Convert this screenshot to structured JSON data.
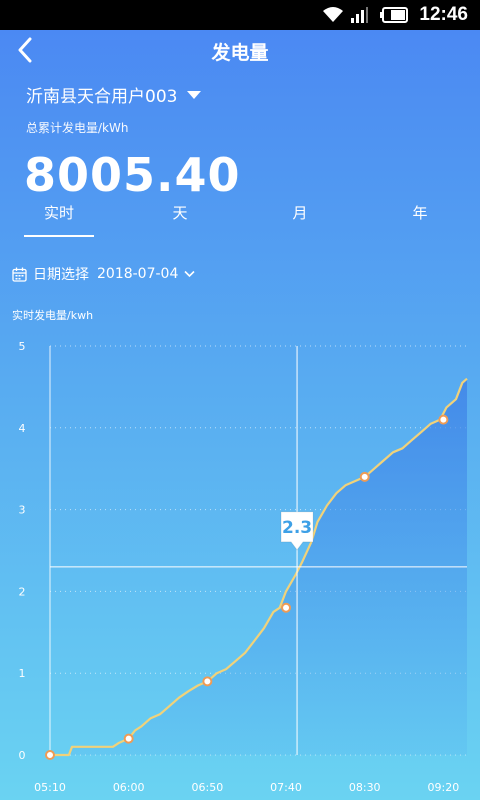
{
  "status": {
    "time": "12:46",
    "icons": [
      "wifi-icon",
      "signal-icon",
      "battery-icon"
    ]
  },
  "nav": {
    "title": "发电量",
    "back_icon": "back-arrow-icon"
  },
  "station": {
    "name": "沂南县天合用户003",
    "dropdown_icon": "caret-down-icon"
  },
  "total": {
    "label": "总累计发电量/kWh",
    "value": "8005.40"
  },
  "tabs": [
    {
      "label": "实时",
      "active": true
    },
    {
      "label": "天",
      "active": false
    },
    {
      "label": "月",
      "active": false
    },
    {
      "label": "年",
      "active": false
    }
  ],
  "date": {
    "label": "日期选择",
    "value": "2018-07-04",
    "icon": "calendar-icon"
  },
  "colors": {
    "line": "#f1d27a",
    "marker_stroke": "#ef9b55",
    "tooltip_text": "#3ea0e6"
  },
  "chart_data": {
    "type": "line",
    "ylabel": "实时发电量/kwh",
    "ylim": [
      0,
      5
    ],
    "yticks": [
      0,
      1,
      2,
      3,
      4,
      5
    ],
    "xlim": [
      "05:10",
      "09:35"
    ],
    "xticks": [
      "05:10",
      "06:00",
      "06:50",
      "07:40",
      "08:30",
      "09:20"
    ],
    "grid": "horizontal-dotted",
    "tooltip": {
      "x": "07:47",
      "y": 2.3,
      "label": "2.3"
    },
    "series": [
      {
        "x": [
          "05:10",
          "05:22",
          "05:24",
          "05:50",
          "05:54",
          "06:00",
          "06:04",
          "06:08",
          "06:14",
          "06:20",
          "06:26",
          "06:32",
          "06:38",
          "06:44",
          "06:50",
          "06:56",
          "07:02",
          "07:08",
          "07:14",
          "07:20",
          "07:26",
          "07:32",
          "07:36",
          "07:40",
          "07:46",
          "07:50",
          "07:56",
          "08:00",
          "08:06",
          "08:12",
          "08:18",
          "08:24",
          "08:30",
          "08:36",
          "08:42",
          "08:48",
          "08:54",
          "09:00",
          "09:06",
          "09:12",
          "09:18",
          "09:22",
          "09:28",
          "09:32",
          "09:35"
        ],
        "y": [
          0.0,
          0.0,
          0.1,
          0.1,
          0.15,
          0.2,
          0.3,
          0.35,
          0.45,
          0.5,
          0.6,
          0.7,
          0.78,
          0.85,
          0.9,
          1.0,
          1.05,
          1.15,
          1.25,
          1.4,
          1.55,
          1.75,
          1.8,
          2.0,
          2.2,
          2.35,
          2.6,
          2.85,
          3.05,
          3.2,
          3.3,
          3.35,
          3.4,
          3.5,
          3.6,
          3.7,
          3.75,
          3.85,
          3.95,
          4.05,
          4.1,
          4.25,
          4.35,
          4.55,
          4.6
        ]
      }
    ],
    "markers": [
      {
        "x": "05:10",
        "y": 0.0
      },
      {
        "x": "06:00",
        "y": 0.2
      },
      {
        "x": "06:50",
        "y": 0.9
      },
      {
        "x": "07:40",
        "y": 1.8
      },
      {
        "x": "08:30",
        "y": 3.4
      },
      {
        "x": "09:20",
        "y": 4.1
      }
    ]
  }
}
